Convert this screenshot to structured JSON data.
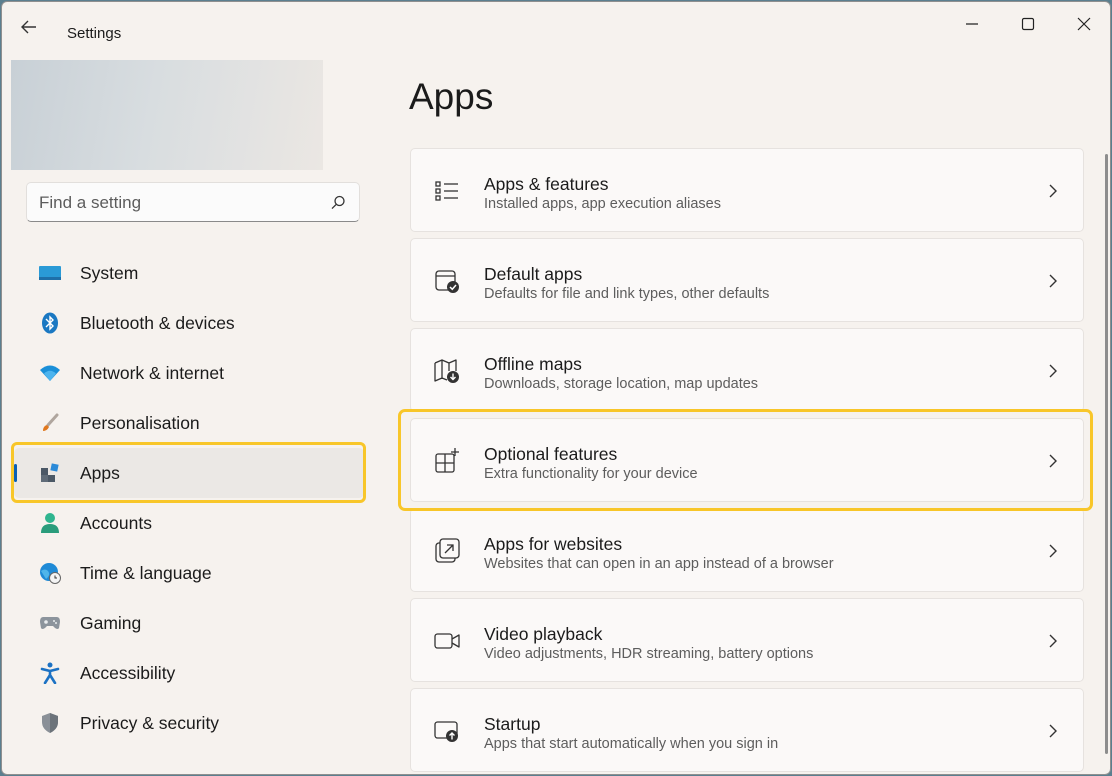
{
  "window": {
    "title": "Settings"
  },
  "sidebar": {
    "search": {
      "placeholder": "Find a setting"
    },
    "items": [
      {
        "label": "System",
        "icon": "monitor-icon",
        "selected": false
      },
      {
        "label": "Bluetooth & devices",
        "icon": "bluetooth-icon",
        "selected": false
      },
      {
        "label": "Network & internet",
        "icon": "wifi-icon",
        "selected": false
      },
      {
        "label": "Personalisation",
        "icon": "brush-icon",
        "selected": false
      },
      {
        "label": "Apps",
        "icon": "apps-icon",
        "selected": true
      },
      {
        "label": "Accounts",
        "icon": "person-icon",
        "selected": false
      },
      {
        "label": "Time & language",
        "icon": "globe-clock-icon",
        "selected": false
      },
      {
        "label": "Gaming",
        "icon": "gamepad-icon",
        "selected": false
      },
      {
        "label": "Accessibility",
        "icon": "accessibility-icon",
        "selected": false
      },
      {
        "label": "Privacy & security",
        "icon": "shield-icon",
        "selected": false
      }
    ]
  },
  "main": {
    "title": "Apps",
    "cards": [
      {
        "title": "Apps & features",
        "subtitle": "Installed apps, app execution aliases",
        "icon": "list-icon"
      },
      {
        "title": "Default apps",
        "subtitle": "Defaults for file and link types, other defaults",
        "icon": "default-apps-icon"
      },
      {
        "title": "Offline maps",
        "subtitle": "Downloads, storage location, map updates",
        "icon": "map-download-icon"
      },
      {
        "title": "Optional features",
        "subtitle": "Extra functionality for your device",
        "icon": "grid-plus-icon"
      },
      {
        "title": "Apps for websites",
        "subtitle": "Websites that can open in an app instead of a browser",
        "icon": "open-external-icon"
      },
      {
        "title": "Video playback",
        "subtitle": "Video adjustments, HDR streaming, battery options",
        "icon": "video-camera-icon"
      },
      {
        "title": "Startup",
        "subtitle": "Apps that start automatically when you sign in",
        "icon": "startup-icon"
      }
    ]
  },
  "colors": {
    "accent": "#0a5fb4",
    "highlight": "#f8c629"
  }
}
